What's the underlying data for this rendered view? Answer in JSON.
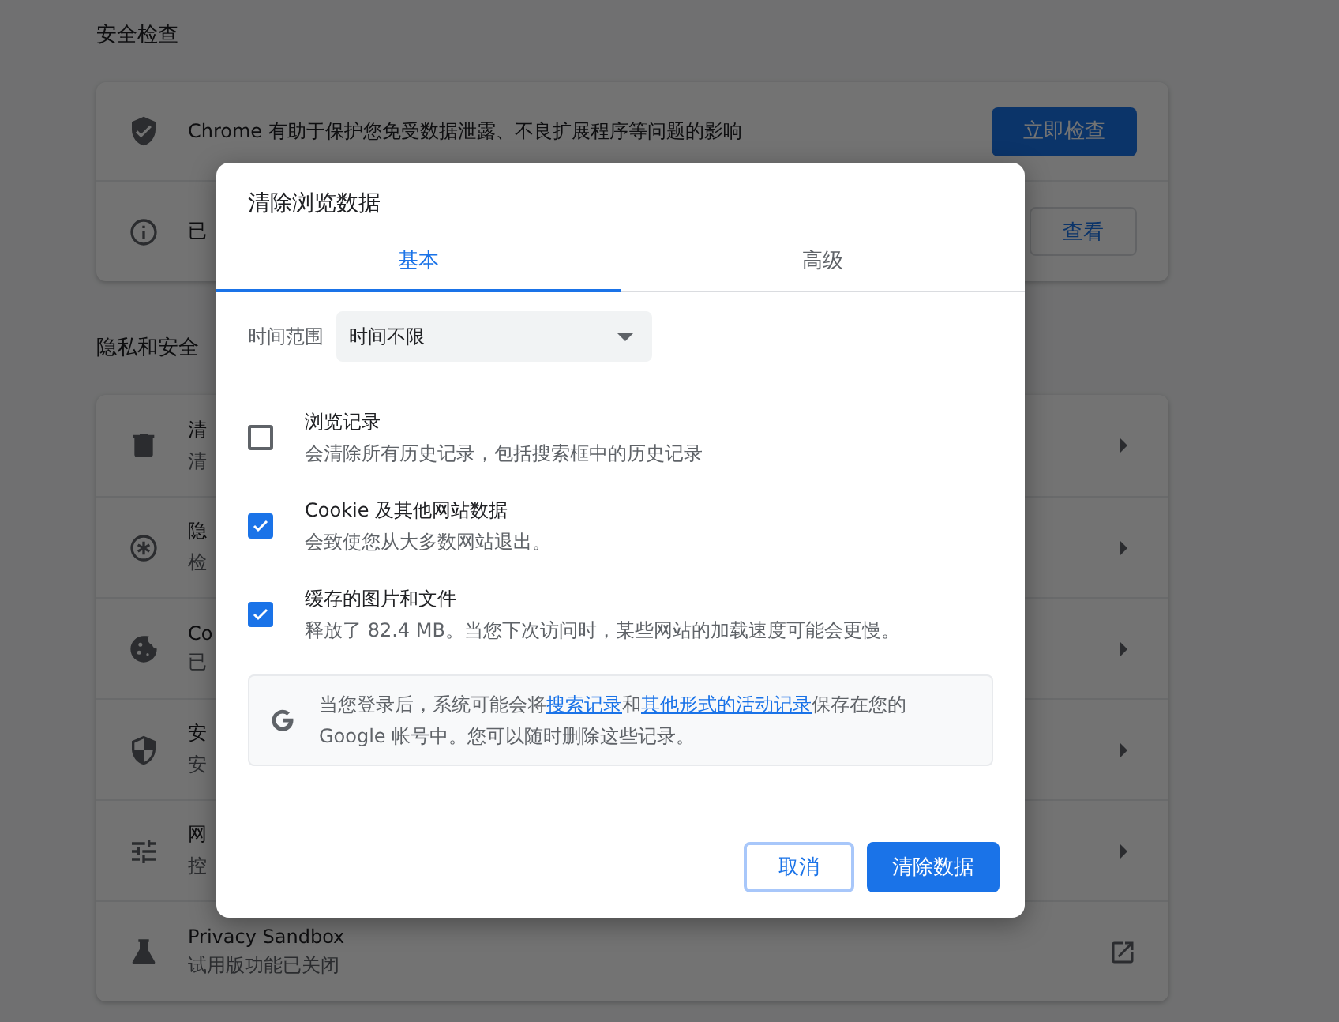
{
  "safety_check": {
    "title": "安全检查",
    "rows": [
      {
        "text": "Chrome 有助于保护您免受数据泄露、不良扩展程序等问题的影响",
        "button": "立即检查",
        "primary": true
      },
      {
        "text": "已",
        "button": "查看",
        "primary": false
      }
    ]
  },
  "privacy": {
    "title": "隐私和安全",
    "rows": [
      {
        "title": "清",
        "subtitle": "清",
        "kind": "arrow"
      },
      {
        "title": "隐",
        "subtitle": "检",
        "kind": "arrow"
      },
      {
        "title": "Co",
        "subtitle": "已",
        "kind": "arrow"
      },
      {
        "title": "安",
        "subtitle": "安",
        "kind": "arrow"
      },
      {
        "title": "网",
        "subtitle": "控",
        "kind": "arrow"
      },
      {
        "title": "Privacy Sandbox",
        "subtitle": "试用版功能已关闭",
        "kind": "external"
      }
    ]
  },
  "dialog": {
    "title": "清除浏览数据",
    "tabs": [
      {
        "label": "基本",
        "selected": true
      },
      {
        "label": "高级",
        "selected": false
      }
    ],
    "time_range": {
      "label": "时间范围",
      "value": "时间不限"
    },
    "options": [
      {
        "title": "浏览记录",
        "description": "会清除所有历史记录，包括搜索框中的历史记录",
        "checked": false
      },
      {
        "title": "Cookie 及其他网站数据",
        "description": "会致使您从大多数网站退出。",
        "checked": true
      },
      {
        "title": "缓存的图片和文件",
        "description": "释放了 82.4 MB。当您下次访问时，某些网站的加载速度可能会更慢。",
        "checked": true
      }
    ],
    "notice": [
      {
        "kind": "text",
        "text": "当您登录后，系统可能会将"
      },
      {
        "kind": "link",
        "text": "搜索记录"
      },
      {
        "kind": "text",
        "text": "和"
      },
      {
        "kind": "link",
        "text": "其他形式的活动记录"
      },
      {
        "kind": "text",
        "text": "保存在您的 Google 帐号中。您可以随时删除这些记录。"
      }
    ],
    "buttons": {
      "cancel": "取消",
      "confirm": "清除数据"
    }
  }
}
